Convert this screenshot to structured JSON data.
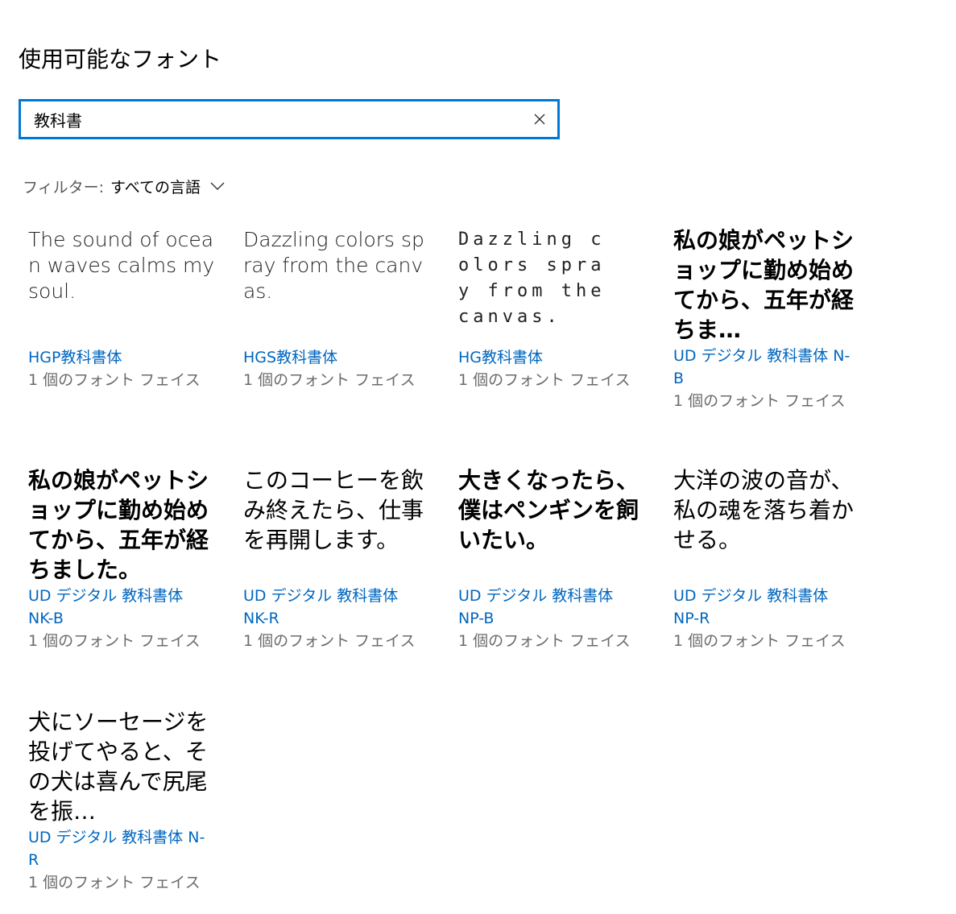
{
  "header": {
    "title": "使用可能なフォント"
  },
  "search": {
    "value": "教科書",
    "clear_icon": "close-icon"
  },
  "filter": {
    "label": "フィルター:",
    "value": "すべての言語",
    "icon": "chevron-down-icon"
  },
  "fonts": [
    {
      "preview": "The sound of ocean waves calms my soul.",
      "name": "HGP教科書体",
      "faces": "1 個のフォント フェイス"
    },
    {
      "preview": "Dazzling colors spray from the canvas.",
      "name": "HGS教科書体",
      "faces": "1 個のフォント フェイス"
    },
    {
      "preview": "Dazzling colors spray from the canvas.",
      "name": "HG教科書体",
      "faces": "1 個のフォント フェイス"
    },
    {
      "preview": "私の娘がペットショップに勤め始めてから、五年が経ちま…",
      "name": "UD デジタル 教科書体 N-B",
      "faces": "1 個のフォント フェイス"
    },
    {
      "preview": "私の娘がペットショップに勤め始めてから、五年が経ちました。",
      "name": "UD デジタル 教科書体 NK-B",
      "faces": "1 個のフォント フェイス"
    },
    {
      "preview": "このコーヒーを飲み終えたら、仕事を再開します。",
      "name": "UD デジタル 教科書体 NK-R",
      "faces": "1 個のフォント フェイス"
    },
    {
      "preview": "大きくなったら、僕はペンギンを飼いたい。",
      "name": "UD デジタル 教科書体 NP-B",
      "faces": "1 個のフォント フェイス"
    },
    {
      "preview": "大洋の波の音が、私の魂を落ち着かせる。",
      "name": "UD デジタル 教科書体 NP-R",
      "faces": "1 個のフォント フェイス"
    },
    {
      "preview": "犬にソーセージを投げてやると、その犬は喜んで尻尾を振…",
      "name": "UD デジタル 教科書体 N-R",
      "faces": "1 個のフォント フェイス"
    }
  ]
}
